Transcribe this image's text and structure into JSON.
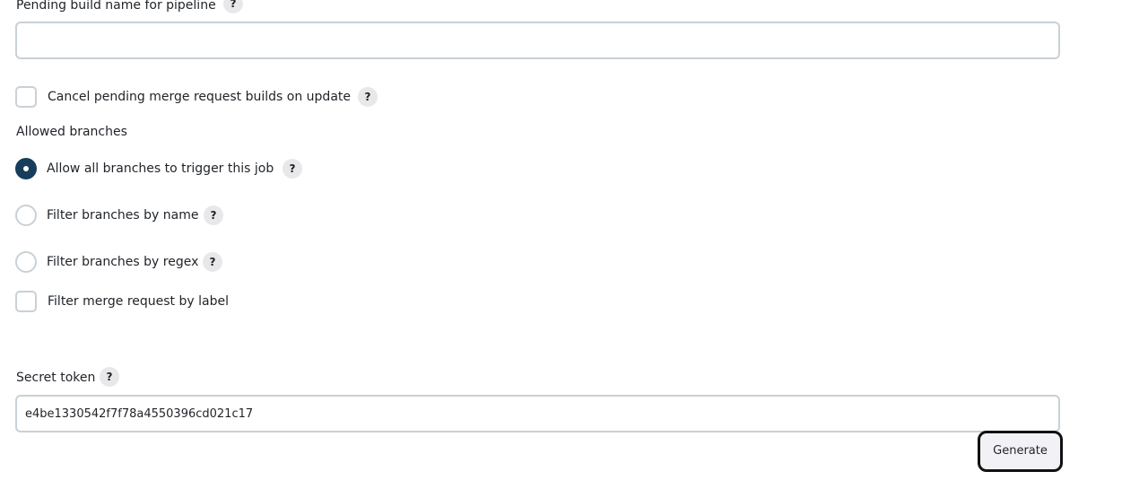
{
  "pending_build_name": {
    "label": "Pending build name for pipeline",
    "help": "?",
    "value": "",
    "placeholder": ""
  },
  "cancel_pending": {
    "label": "Cancel pending merge request builds on update",
    "help": "?",
    "checked": false
  },
  "allowed_branches": {
    "label": "Allowed branches",
    "options": [
      {
        "label": "Allow all branches to trigger this job",
        "help": "?",
        "selected": true
      },
      {
        "label": "Filter branches by name",
        "help": "?",
        "selected": false
      },
      {
        "label": "Filter branches by regex",
        "help": "?",
        "selected": false
      }
    ]
  },
  "filter_label": {
    "label": "Filter merge request by label",
    "checked": false
  },
  "secret_token": {
    "label": "Secret token",
    "help": "?",
    "value": "e4be1330542f7f78a4550396cd021c17"
  },
  "generate_button": {
    "label": "Generate"
  },
  "colors": {
    "radio_selected": "#173d5a",
    "input_border": "#c9d1d6",
    "help_bg": "#e8e8ea",
    "button_border": "#111111"
  }
}
